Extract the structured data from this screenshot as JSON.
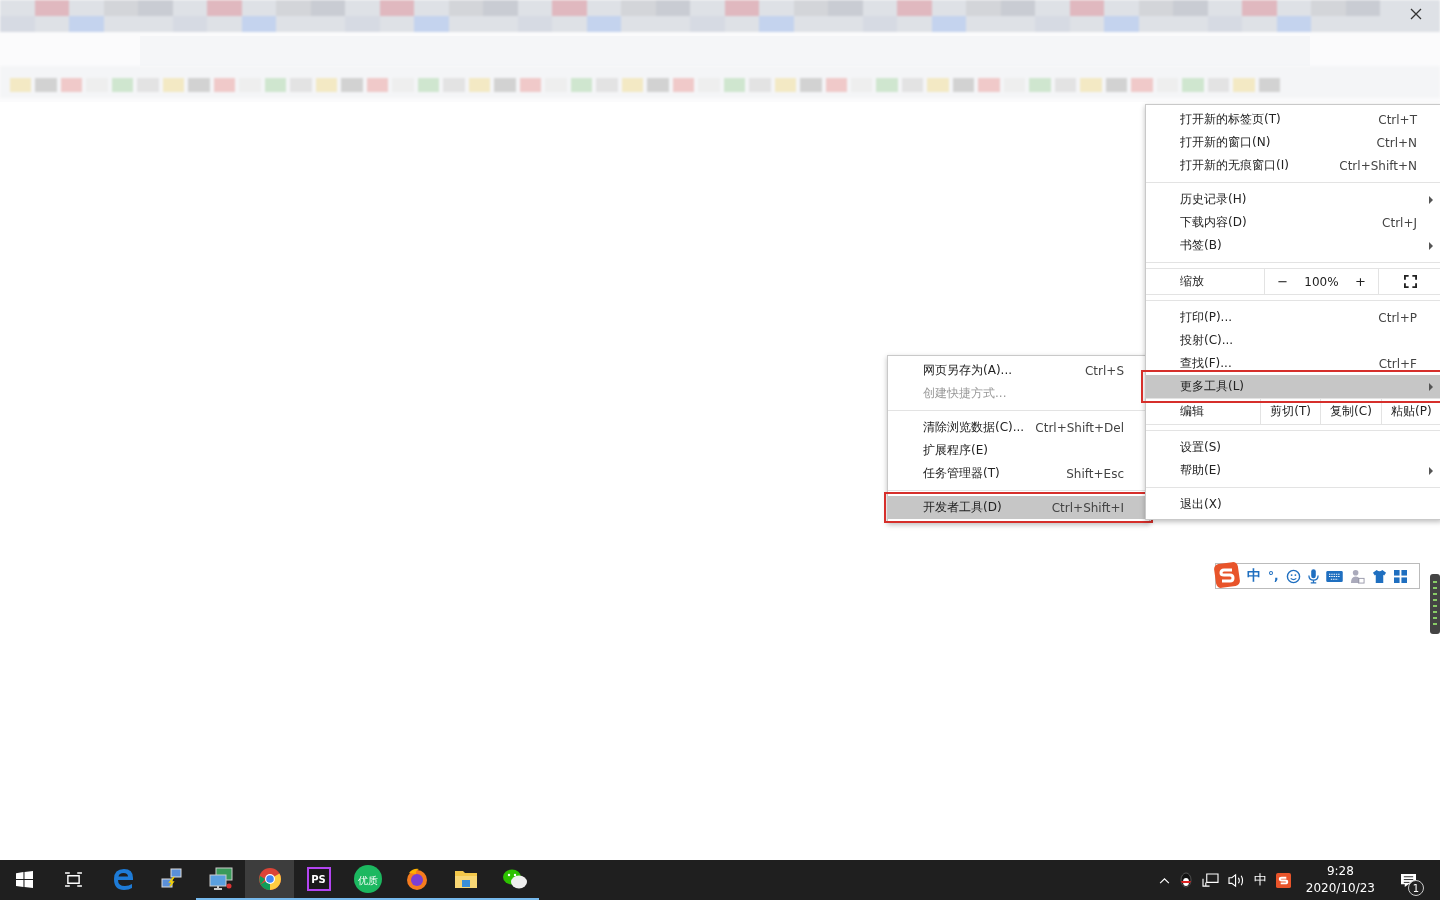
{
  "main_menu": {
    "items": [
      {
        "kind": "item",
        "label": "打开新的标签页(T)",
        "shortcut": "Ctrl+T",
        "submenu": false,
        "selected": false
      },
      {
        "kind": "item",
        "label": "打开新的窗口(N)",
        "shortcut": "Ctrl+N",
        "submenu": false,
        "selected": false
      },
      {
        "kind": "item",
        "label": "打开新的无痕窗口(I)",
        "shortcut": "Ctrl+Shift+N",
        "submenu": false,
        "selected": false
      },
      {
        "kind": "separator"
      },
      {
        "kind": "item",
        "label": "历史记录(H)",
        "submenu": true,
        "selected": false
      },
      {
        "kind": "item",
        "label": "下载内容(D)",
        "shortcut": "Ctrl+J",
        "submenu": false,
        "selected": false
      },
      {
        "kind": "item",
        "label": "书签(B)",
        "submenu": true,
        "selected": false
      },
      {
        "kind": "separator"
      },
      {
        "kind": "zoom",
        "label": "缩放",
        "minus": "−",
        "value": "100%",
        "plus": "+"
      },
      {
        "kind": "separator"
      },
      {
        "kind": "item",
        "label": "打印(P)...",
        "shortcut": "Ctrl+P",
        "submenu": false,
        "selected": false
      },
      {
        "kind": "item",
        "label": "投射(C)...",
        "submenu": false,
        "selected": false
      },
      {
        "kind": "item",
        "label": "查找(F)...",
        "shortcut": "Ctrl+F",
        "submenu": false,
        "selected": false
      },
      {
        "kind": "item",
        "label": "更多工具(L)",
        "submenu": true,
        "selected": true
      },
      {
        "kind": "edit",
        "label": "编辑",
        "buttons": [
          "剪切(T)",
          "复制(C)",
          "粘贴(P)"
        ]
      },
      {
        "kind": "separator"
      },
      {
        "kind": "item",
        "label": "设置(S)",
        "submenu": false,
        "selected": false
      },
      {
        "kind": "item",
        "label": "帮助(E)",
        "submenu": true,
        "selected": false
      },
      {
        "kind": "separator"
      },
      {
        "kind": "item",
        "label": "退出(X)",
        "submenu": false,
        "selected": false
      }
    ]
  },
  "submenu": {
    "items": [
      {
        "kind": "item",
        "label": "网页另存为(A)...",
        "shortcut": "Ctrl+S",
        "disabled": false,
        "selected": false
      },
      {
        "kind": "item",
        "label": "创建快捷方式...",
        "disabled": true,
        "selected": false
      },
      {
        "kind": "separator"
      },
      {
        "kind": "item",
        "label": "清除浏览数据(C)...",
        "shortcut": "Ctrl+Shift+Del",
        "disabled": false,
        "selected": false
      },
      {
        "kind": "item",
        "label": "扩展程序(E)",
        "disabled": false,
        "selected": false
      },
      {
        "kind": "item",
        "label": "任务管理器(T)",
        "shortcut": "Shift+Esc",
        "disabled": false,
        "selected": false
      },
      {
        "kind": "separator"
      },
      {
        "kind": "item",
        "label": "开发者工具(D)",
        "shortcut": "Ctrl+Shift+I",
        "disabled": false,
        "selected": true
      }
    ]
  },
  "ime_toolbar": {
    "mode": "中",
    "punctuation": "°,"
  },
  "taskbar": {
    "apps": [
      {
        "kind": "start",
        "selected": false,
        "running": false
      },
      {
        "kind": "taskview",
        "selected": false,
        "running": false
      },
      {
        "kind": "edge",
        "selected": false,
        "running": false
      },
      {
        "kind": "network",
        "selected": false,
        "running": false
      },
      {
        "kind": "remote",
        "selected": false,
        "running": true
      },
      {
        "kind": "chrome",
        "selected": true,
        "running": true
      },
      {
        "kind": "phpstorm",
        "label": "PS",
        "selected": false,
        "running": true
      },
      {
        "kind": "badge",
        "label": "优质",
        "selected": false,
        "running": true
      },
      {
        "kind": "firefox",
        "selected": false,
        "running": true
      },
      {
        "kind": "folder",
        "selected": false,
        "running": true
      },
      {
        "kind": "wechat",
        "selected": false,
        "running": true
      }
    ],
    "tray": {
      "input_mode": "中",
      "time": "9:28",
      "date": "2020/10/23",
      "notifications": "1"
    }
  }
}
